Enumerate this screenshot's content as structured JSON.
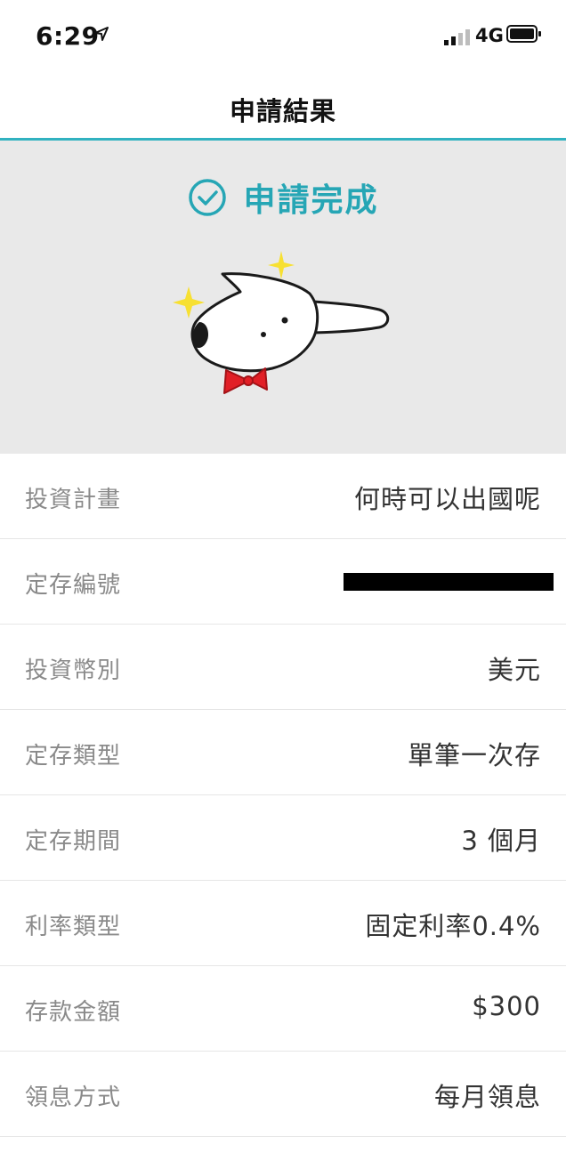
{
  "status_bar": {
    "time": "6:29",
    "network": "4G"
  },
  "nav": {
    "title": "申請結果"
  },
  "hero": {
    "status_text": "申請完成"
  },
  "details": [
    {
      "label": "投資計畫",
      "value": "何時可以出國呢"
    },
    {
      "label": "定存編號",
      "value": ""
    },
    {
      "label": "投資幣別",
      "value": "美元"
    },
    {
      "label": "定存類型",
      "value": "單筆一次存"
    },
    {
      "label": "定存期間",
      "value": "3 個月"
    },
    {
      "label": "利率類型",
      "value": "固定利率0.4%"
    },
    {
      "label": "存款金額",
      "value": "$300"
    },
    {
      "label": "領息方式",
      "value": "每月領息"
    }
  ],
  "colors": {
    "accent": "#26a6b5",
    "divider": "#31b2c0",
    "hero_bg": "#e9e9e9"
  }
}
